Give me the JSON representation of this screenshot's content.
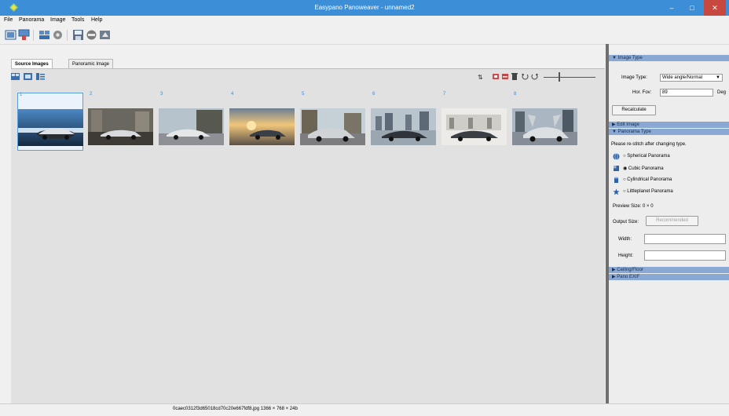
{
  "window": {
    "title": "Easypano Panoweaver - unnamed2",
    "minimize": "–",
    "maximize": "□",
    "close": "✕"
  },
  "menu": [
    "File",
    "Panorama",
    "Image",
    "Tools",
    "Help"
  ],
  "toolbar": {
    "icons": [
      "new-project-icon",
      "open-project-icon",
      "stitch-icon",
      "settings-icon",
      "save-icon",
      "publish-icon",
      "export-icon"
    ]
  },
  "tabs": [
    {
      "label": "Source Images",
      "active": true
    },
    {
      "label": "Panoramic Image",
      "active": false
    }
  ],
  "thumbnails": [
    {
      "number": "1",
      "selected": true
    },
    {
      "number": "2",
      "selected": false
    },
    {
      "number": "3",
      "selected": false
    },
    {
      "number": "4",
      "selected": false
    },
    {
      "number": "5",
      "selected": false
    },
    {
      "number": "6",
      "selected": false
    },
    {
      "number": "7",
      "selected": false
    },
    {
      "number": "8",
      "selected": false
    }
  ],
  "panel": {
    "image_type": {
      "header": "▼ Image Type",
      "label": "Image Type:",
      "value": "Wide angle/Normal",
      "hfov_label": "Hor. Fov:",
      "hfov_value": "89",
      "unit": "Deg",
      "recalculate": "Recalculate"
    },
    "edit_image": {
      "header": "▶ Edit Image"
    },
    "panorama_type": {
      "header": "▼ Panorama Type",
      "note": "Please re-stitch after changing type.",
      "options": [
        {
          "label": "Spherical Panorama",
          "checked": false
        },
        {
          "label": "Cubic Panorama",
          "checked": true
        },
        {
          "label": "Cylindrical Panorama",
          "checked": false
        },
        {
          "label": "Littleplanet Panorama",
          "checked": false
        }
      ],
      "preview_size": "Preview Size: 0 × 0",
      "output_size_label": "Output Size:",
      "recommended": "Recommended",
      "width_label": "Width:",
      "height_label": "Height:"
    },
    "ceiling_floor": {
      "header": "▶ Ceiling/Floor"
    },
    "pano_exif": {
      "header": "▶ Pano EXIF"
    }
  },
  "status": {
    "text": "0caec0312f3d65018cd70c20e667fdf8.jpg 1366 × 768 × 24b"
  },
  "colors": {
    "titlebar": "#3c8ed6",
    "selection": "#5a9edf",
    "section_header": "#89a8d3",
    "close": "#c7483f"
  }
}
